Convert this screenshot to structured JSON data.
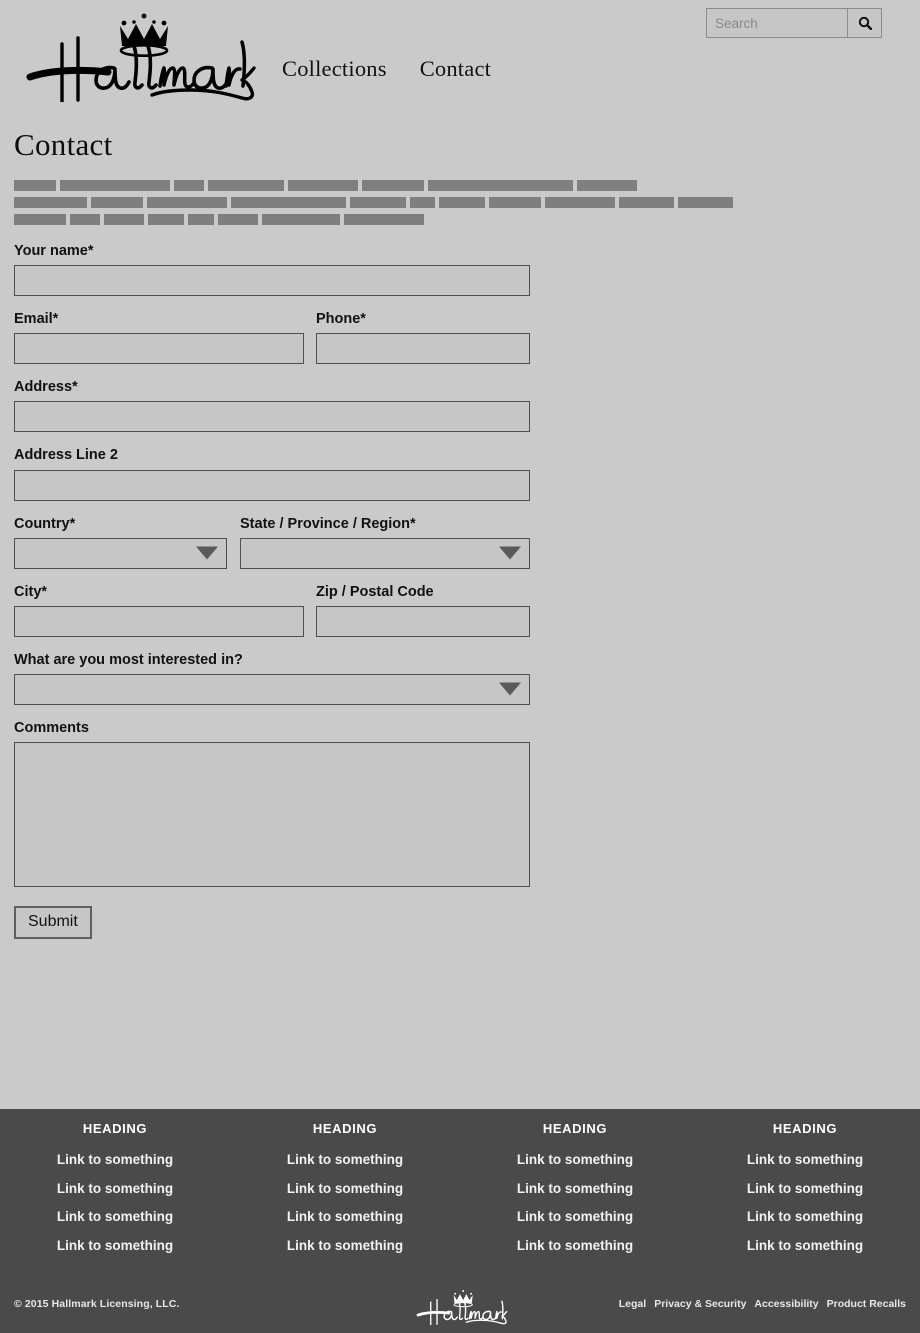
{
  "colors": {
    "page_bg": "#cacaca",
    "footer_bg": "#4a4a4a",
    "field_border": "#4f4f4f",
    "placeholder_bar": "#7f7f7f",
    "text": "#111111"
  },
  "header": {
    "logo_alt": "Hallmark",
    "nav": [
      {
        "label": "Collections"
      },
      {
        "label": "Contact"
      }
    ],
    "search": {
      "placeholder": "Search",
      "value": "",
      "button_icon": "search-icon"
    }
  },
  "main": {
    "page_title": "Contact",
    "placeholder_bars": [
      [
        42,
        110,
        30,
        76,
        70,
        62,
        145,
        60
      ],
      [
        73,
        52,
        80,
        115,
        56,
        25,
        46,
        52,
        70,
        55,
        55
      ],
      [
        52,
        30,
        40,
        36,
        26,
        40,
        78,
        80
      ]
    ],
    "form": {
      "fields": [
        {
          "id": "your-name",
          "label": "Your name*",
          "type": "text",
          "value": ""
        },
        {
          "id": "email",
          "label": "Email*",
          "type": "text",
          "value": ""
        },
        {
          "id": "phone",
          "label": "Phone*",
          "type": "text",
          "value": ""
        },
        {
          "id": "address",
          "label": "Address*",
          "type": "text",
          "value": ""
        },
        {
          "id": "address-2",
          "label": "Address Line 2",
          "type": "text",
          "value": ""
        },
        {
          "id": "country",
          "label": "Country*",
          "type": "select",
          "value": ""
        },
        {
          "id": "state",
          "label": "State / Province / Region*",
          "type": "select",
          "value": ""
        },
        {
          "id": "city",
          "label": "City*",
          "type": "text",
          "value": ""
        },
        {
          "id": "zip",
          "label": "Zip / Postal Code",
          "type": "text",
          "value": ""
        },
        {
          "id": "interest",
          "label": "What are you most interested in?",
          "type": "select",
          "value": ""
        },
        {
          "id": "comments",
          "label": "Comments",
          "type": "textarea",
          "value": ""
        }
      ],
      "submit_label": "Submit"
    }
  },
  "footer": {
    "columns": [
      {
        "heading": "HEADING",
        "links": [
          "Link to something",
          "Link to something",
          "Link to something",
          "Link to something"
        ]
      },
      {
        "heading": "HEADING",
        "links": [
          "Link to something",
          "Link to something",
          "Link to something",
          "Link to something"
        ]
      },
      {
        "heading": "HEADING",
        "links": [
          "Link to something",
          "Link to something",
          "Link to something",
          "Link to something"
        ]
      },
      {
        "heading": "HEADING",
        "links": [
          "Link to something",
          "Link to something",
          "Link to something",
          "Link to something"
        ]
      }
    ],
    "copyright": "© 2015 Hallmark Licensing, LLC.",
    "logo_alt": "Hallmark",
    "legal_links": [
      "Legal",
      "Privacy & Security",
      "Accessibility",
      "Product Recalls"
    ]
  }
}
